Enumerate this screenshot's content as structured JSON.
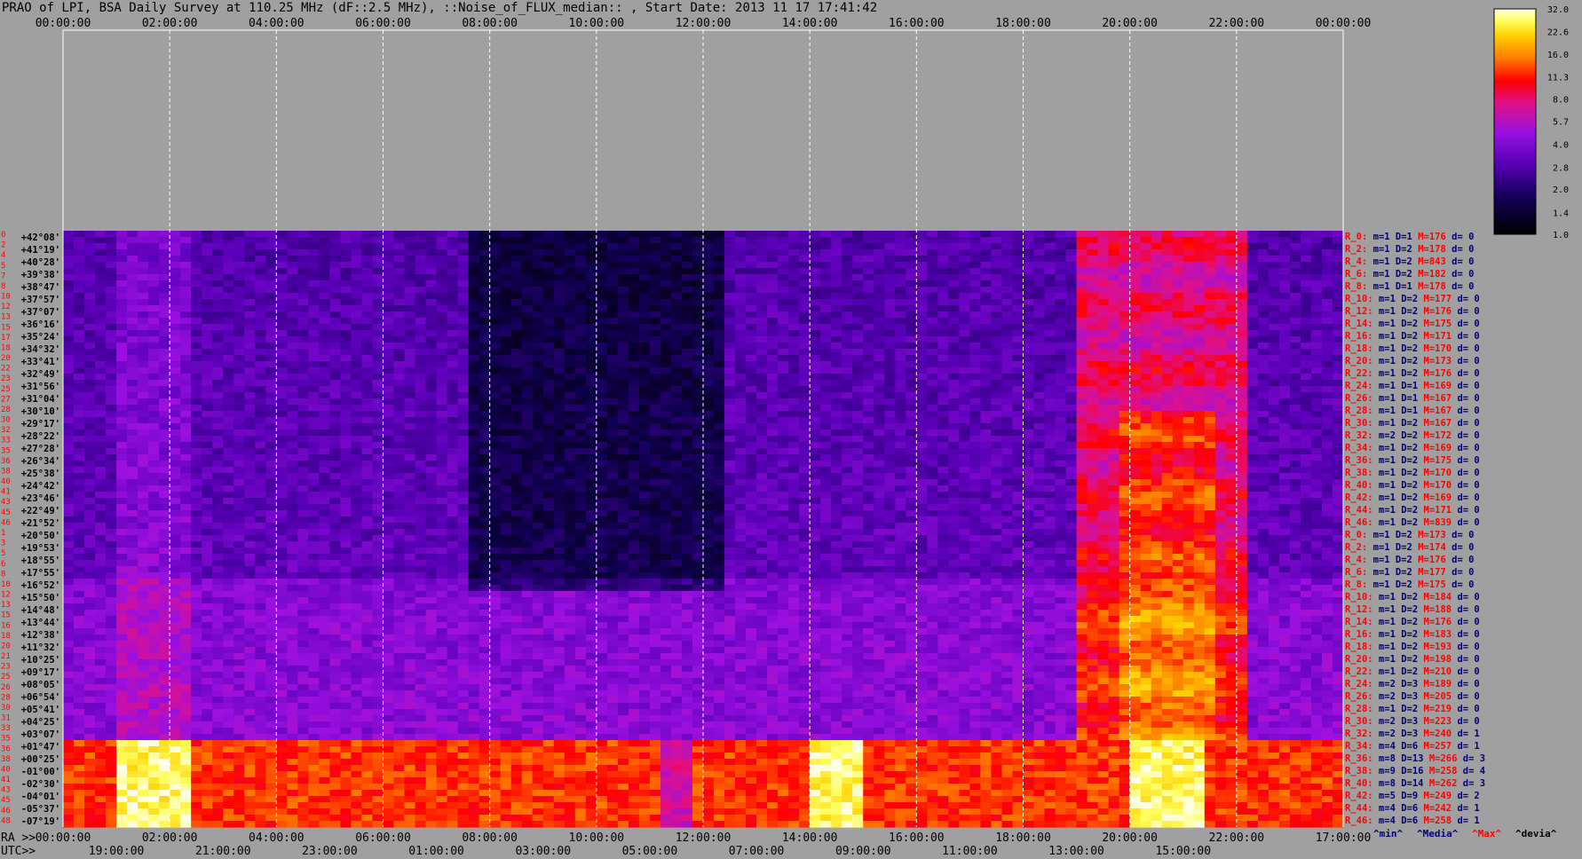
{
  "title": "PRAO of LPI, BSA Daily Survey at 110.25 MHz (dF::2.5 MHz), ::Noise_of_FLUX_median:: , Start Date: 2013 11 17 17:41:42",
  "colors": {
    "background": "#a0a0a0",
    "grid": "#ffffff",
    "label_blue": "#000080",
    "label_red": "#ff0000"
  },
  "chart_data": {
    "type": "heatmap",
    "top_axis_ticks": [
      "00:00:00",
      "02:00:00",
      "04:00:00",
      "06:00:00",
      "08:00:00",
      "10:00:00",
      "12:00:00",
      "14:00:00",
      "16:00:00",
      "18:00:00",
      "20:00:00",
      "22:00:00",
      "00:00:00"
    ],
    "bottom_ra_label": "RA >>",
    "bottom_ra_ticks": [
      "00:00:00",
      "02:00:00",
      "04:00:00",
      "06:00:00",
      "08:00:00",
      "10:00:00",
      "12:00:00",
      "14:00:00",
      "16:00:00",
      "18:00:00",
      "20:00:00",
      "22:00:00",
      "17:00:00"
    ],
    "bottom_utc_label": "UTC>>",
    "bottom_utc_ticks": [
      "19:00:00",
      "21:00:00",
      "23:00:00",
      "01:00:00",
      "03:00:00",
      "05:00:00",
      "07:00:00",
      "09:00:00",
      "11:00:00",
      "13:00:00",
      "15:00:00"
    ],
    "row_index_labels": [
      "0",
      "2",
      "4",
      "5",
      "7",
      "8",
      "10",
      "12",
      "13",
      "15",
      "17",
      "18",
      "20",
      "22",
      "23",
      "25",
      "27",
      "28",
      "30",
      "32",
      "33",
      "35",
      "36",
      "38",
      "40",
      "41",
      "43",
      "45",
      "46",
      "1",
      "3",
      "5",
      "6",
      "8",
      "10",
      "12",
      "13",
      "15",
      "16",
      "18",
      "20",
      "21",
      "23",
      "25",
      "26",
      "28",
      "30",
      "31",
      "33",
      "35",
      "36",
      "38",
      "40",
      "41",
      "43",
      "45",
      "46",
      "48"
    ],
    "declination_labels": [
      "+42°08'",
      "+41°19'",
      "+40°28'",
      "+39°38'",
      "+38°47'",
      "+37°57'",
      "+37°07'",
      "+36°16'",
      "+35°24'",
      "+34°32'",
      "+33°41'",
      "+32°49'",
      "+31°56'",
      "+31°04'",
      "+30°10'",
      "+29°17'",
      "+28°22'",
      "+27°28'",
      "+26°34'",
      "+25°38'",
      "+24°42'",
      "+23°46'",
      "+22°49'",
      "+21°52'",
      "+20°50'",
      "+19°53'",
      "+18°55'",
      "+17°55'",
      "+16°52'",
      "+15°50'",
      "+14°48'",
      "+13°44'",
      "+12°38'",
      "+11°32'",
      "+10°25'",
      "+09°17'",
      "+08°05'",
      "+06°54'",
      "+05°41'",
      "+04°25'",
      "+03°07'",
      "+01°47'",
      "+00°25'",
      "-01°00'",
      "-02°30'",
      "-04°01'",
      "-05°37'",
      "-07°19'"
    ],
    "beam_stats": [
      [
        "R_0:",
        "m=1 D=1",
        "M=176",
        "d= 0"
      ],
      [
        "R_2:",
        "m=1 D=2",
        "M=178",
        "d= 0"
      ],
      [
        "R_4:",
        "m=1 D=2",
        "M=843",
        "d= 0"
      ],
      [
        "R_6:",
        "m=1 D=2",
        "M=182",
        "d= 0"
      ],
      [
        "R_8:",
        "m=1 D=1",
        "M=178",
        "d= 0"
      ],
      [
        "R_10:",
        "m=1 D=2",
        "M=177",
        "d= 0"
      ],
      [
        "R_12:",
        "m=1 D=2",
        "M=176",
        "d= 0"
      ],
      [
        "R_14:",
        "m=1 D=2",
        "M=175",
        "d= 0"
      ],
      [
        "R_16:",
        "m=1 D=2",
        "M=171",
        "d= 0"
      ],
      [
        "R_18:",
        "m=1 D=2",
        "M=170",
        "d= 0"
      ],
      [
        "R_20:",
        "m=1 D=2",
        "M=173",
        "d= 0"
      ],
      [
        "R_22:",
        "m=1 D=2",
        "M=176",
        "d= 0"
      ],
      [
        "R_24:",
        "m=1 D=1",
        "M=169",
        "d= 0"
      ],
      [
        "R_26:",
        "m=1 D=1",
        "M=167",
        "d= 0"
      ],
      [
        "R_28:",
        "m=1 D=1",
        "M=167",
        "d= 0"
      ],
      [
        "R_30:",
        "m=1 D=2",
        "M=167",
        "d= 0"
      ],
      [
        "R_32:",
        "m=2 D=2",
        "M=172",
        "d= 0"
      ],
      [
        "R_34:",
        "m=1 D=2",
        "M=169",
        "d= 0"
      ],
      [
        "R_36:",
        "m=1 D=2",
        "M=175",
        "d= 0"
      ],
      [
        "R_38:",
        "m=1 D=2",
        "M=170",
        "d= 0"
      ],
      [
        "R_40:",
        "m=1 D=2",
        "M=170",
        "d= 0"
      ],
      [
        "R_42:",
        "m=1 D=2",
        "M=169",
        "d= 0"
      ],
      [
        "R_44:",
        "m=1 D=2",
        "M=171",
        "d= 0"
      ],
      [
        "R_46:",
        "m=1 D=2",
        "M=839",
        "d= 0"
      ],
      [
        "R_0:",
        "m=1 D=2",
        "M=173",
        "d= 0"
      ],
      [
        "R_2:",
        "m=1 D=2",
        "M=174",
        "d= 0"
      ],
      [
        "R_4:",
        "m=1 D=2",
        "M=176",
        "d= 0"
      ],
      [
        "R_6:",
        "m=1 D=2",
        "M=177",
        "d= 0"
      ],
      [
        "R_8:",
        "m=1 D=2",
        "M=175",
        "d= 0"
      ],
      [
        "R_10:",
        "m=1 D=2",
        "M=184",
        "d= 0"
      ],
      [
        "R_12:",
        "m=1 D=2",
        "M=188",
        "d= 0"
      ],
      [
        "R_14:",
        "m=1 D=2",
        "M=176",
        "d= 0"
      ],
      [
        "R_16:",
        "m=1 D=2",
        "M=183",
        "d= 0"
      ],
      [
        "R_18:",
        "m=1 D=2",
        "M=193",
        "d= 0"
      ],
      [
        "R_20:",
        "m=1 D=2",
        "M=198",
        "d= 0"
      ],
      [
        "R_22:",
        "m=1 D=2",
        "M=210",
        "d= 0"
      ],
      [
        "R_24:",
        "m=2 D=3",
        "M=189",
        "d= 0"
      ],
      [
        "R_26:",
        "m=2 D=3",
        "M=205",
        "d= 0"
      ],
      [
        "R_28:",
        "m=1 D=2",
        "M=219",
        "d= 0"
      ],
      [
        "R_30:",
        "m=2 D=3",
        "M=223",
        "d= 0"
      ],
      [
        "R_32:",
        "m=2 D=3",
        "M=240",
        "d= 1"
      ],
      [
        "R_34:",
        "m=4 D=6",
        "M=257",
        "d= 1"
      ],
      [
        "R_36:",
        "m=8 D=13",
        "M=266",
        "d= 3"
      ],
      [
        "R_38:",
        "m=9 D=16",
        "M=258",
        "d= 4"
      ],
      [
        "R_40:",
        "m=8 D=14",
        "M=262",
        "d= 3"
      ],
      [
        "R_42:",
        "m=5 D=9",
        "M=249",
        "d= 2"
      ],
      [
        "R_44:",
        "m=4 D=6",
        "M=242",
        "d= 1"
      ],
      [
        "R_46:",
        "m=4 D=6",
        "M=258",
        "d= 1"
      ]
    ],
    "stats_footer": [
      "^min^",
      "^Media^",
      "^Max^",
      "^devia^"
    ],
    "colorbar_ticks": [
      32.0,
      22.6,
      16.0,
      11.3,
      8.0,
      5.7,
      4.0,
      2.8,
      2.0,
      1.4,
      1.0
    ],
    "colorbar_range": [
      1.0,
      32.0
    ],
    "colorbar_scale": "log",
    "x_range_hours": [
      0,
      24
    ],
    "grid": true
  }
}
